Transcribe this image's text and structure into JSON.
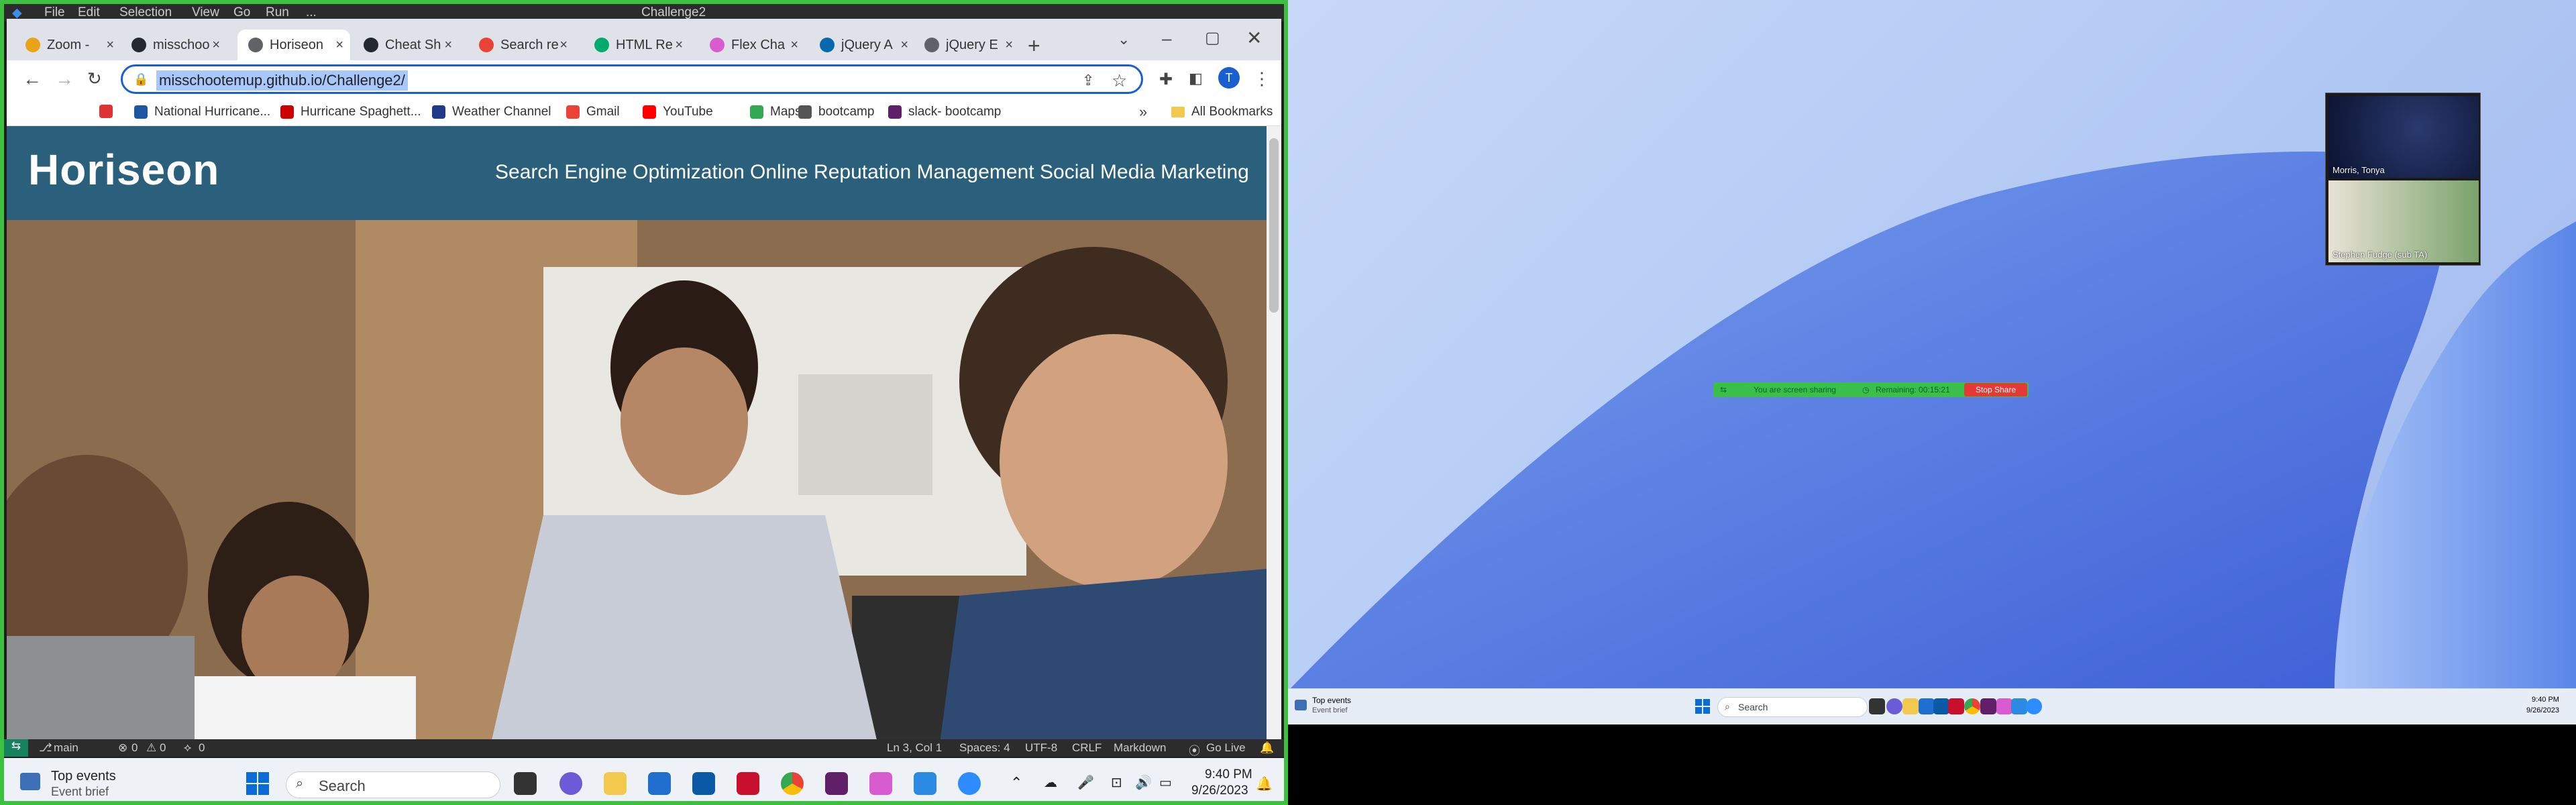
{
  "vscode": {
    "title": "Challenge2",
    "menu": [
      "File",
      "Edit",
      "Selection",
      "View",
      "Go",
      "Run",
      "..."
    ],
    "status": {
      "branch": "main",
      "errors": "0",
      "warnings": "0",
      "ports": "0",
      "cursor": "Ln 3, Col 1",
      "spaces": "Spaces: 4",
      "encoding": "UTF-8",
      "eol": "CRLF",
      "language": "Markdown",
      "golive": "Go Live"
    }
  },
  "browser": {
    "tabs": [
      {
        "label": "Zoom - ",
        "icon": "zoom-icon",
        "color": "#e8a317"
      },
      {
        "label": "misschoo",
        "icon": "github-icon",
        "color": "#24292f"
      },
      {
        "label": "Horiseon",
        "icon": "globe-icon",
        "color": "#5f6368"
      },
      {
        "label": "Cheat Sh",
        "icon": "github-icon",
        "color": "#24292f"
      },
      {
        "label": "Search re",
        "icon": "gmail-icon",
        "color": "#ea4335"
      },
      {
        "label": "HTML Re",
        "icon": "w3schools-icon",
        "color": "#04aa6d"
      },
      {
        "label": "Flex Cha",
        "icon": "flex-icon",
        "color": "#d95bd0"
      },
      {
        "label": "jQuery A",
        "icon": "jquery-icon",
        "color": "#0769ad"
      },
      {
        "label": "jQuery E",
        "icon": "globe-icon",
        "color": "#5f6368"
      }
    ],
    "active_tab_index": 2,
    "url": "misschootemup.github.io/Challenge2/",
    "profile_initial": "T",
    "bookmarks": [
      {
        "label": "",
        "icon": "mouse-icon",
        "color": "#d33"
      },
      {
        "label": "National Hurricane...",
        "icon": "noaa-icon",
        "color": "#1d57a3"
      },
      {
        "label": "Hurricane Spaghett...",
        "icon": "hurricane-icon",
        "color": "#c00"
      },
      {
        "label": "Weather Channel",
        "icon": "weather-icon",
        "color": "#1f3a8a"
      },
      {
        "label": "Gmail",
        "icon": "gmail-icon",
        "color": "#ea4335"
      },
      {
        "label": "YouTube",
        "icon": "youtube-icon",
        "color": "#ff0000"
      },
      {
        "label": "Maps",
        "icon": "maps-icon",
        "color": "#34a853"
      },
      {
        "label": "bootcamp",
        "icon": "globe-icon",
        "color": "#555"
      },
      {
        "label": "slack- bootcamp",
        "icon": "slack-icon",
        "color": "#611f69"
      }
    ],
    "all_bookmarks": "All Bookmarks"
  },
  "site": {
    "logo": "Horiseon",
    "nav": [
      "Search Engine Optimization",
      "Online Reputation Management",
      "Social Media Marketing"
    ]
  },
  "taskbar_left": {
    "widget_title": "Top events",
    "widget_sub": "Event brief",
    "search": "Search",
    "time": "9:40 PM",
    "date": "9/26/2023"
  },
  "zoom": {
    "participants": [
      "Morris, Tonya",
      "Stephen Fudge (sub TA)"
    ],
    "sharing_text": "You are screen sharing",
    "remaining": "Remaining: 00:15:21",
    "stop_share": "Stop Share"
  },
  "taskbar_right": {
    "widget_title": "Top events",
    "widget_sub": "Event brief",
    "search": "Search",
    "time": "9:40 PM",
    "date": "9/26/2023"
  }
}
